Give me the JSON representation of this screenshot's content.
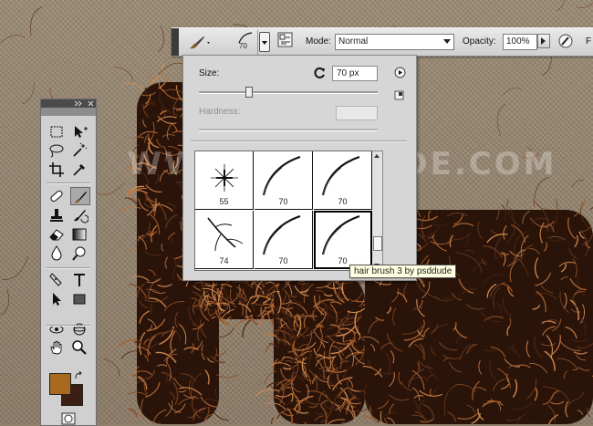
{
  "options_bar": {
    "tool_icon": "brush-icon",
    "brush_size": "70",
    "mode_label": "Mode:",
    "mode_value": "Normal",
    "opacity_label": "Opacity:",
    "opacity_value": "100%",
    "trailing_label": "F"
  },
  "brush_panel": {
    "size_label": "Size:",
    "size_value": "70 px",
    "hardness_label": "Hardness:",
    "size_slider_fraction": 0.28,
    "brushes": [
      {
        "size": "55",
        "shape": "star"
      },
      {
        "size": "70",
        "shape": "hair"
      },
      {
        "size": "70",
        "shape": "hair"
      },
      {
        "size": "74",
        "shape": "branch"
      },
      {
        "size": "70",
        "shape": "hair"
      },
      {
        "size": "70",
        "shape": "hair",
        "selected": true
      }
    ],
    "tooltip": "hair brush 3 by psddude"
  },
  "watermark": "WWW.PSD-DUDE.COM",
  "toolbox": {
    "tools": [
      "marquee-icon",
      "move-icon",
      "lasso-icon",
      "magic-wand-icon",
      "crop-icon",
      "eyedropper-icon",
      "spot-healing-icon",
      "brush-icon",
      "clone-stamp-icon",
      "history-brush-icon",
      "eraser-icon",
      "gradient-icon",
      "blur-icon",
      "dodge-icon",
      "pen-icon",
      "type-icon",
      "path-selection-icon",
      "rectangle-icon",
      "3d-rotate-icon",
      "3d-orbit-icon",
      "hand-icon",
      "zoom-icon"
    ],
    "foreground_color": "#a8681d",
    "background_color": "#3c1e12"
  }
}
